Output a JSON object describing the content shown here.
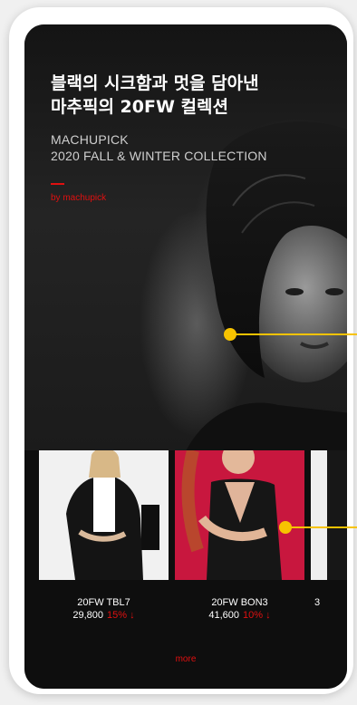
{
  "hero": {
    "title": "블랙의 시크함과 멋을 담아낸\n마추픽의 20FW 컬렉션",
    "subtitle": "MACHUPICK\n2020 FALL & WINTER COLLECTION",
    "byline": "by machupick"
  },
  "products": [
    {
      "name": "20FW TBL7",
      "price": "29,800",
      "discount": "15%",
      "discount_icon": "down-arrow-icon"
    },
    {
      "name": "20FW BON3",
      "price": "41,600",
      "discount": "10%",
      "discount_icon": "down-arrow-icon"
    },
    {
      "name": "",
      "price": "3",
      "discount": "",
      "discount_icon": ""
    }
  ],
  "more_label": "more",
  "colors": {
    "accent": "#e01010",
    "callout": "#f7c300",
    "background": "#0e0e0e"
  }
}
